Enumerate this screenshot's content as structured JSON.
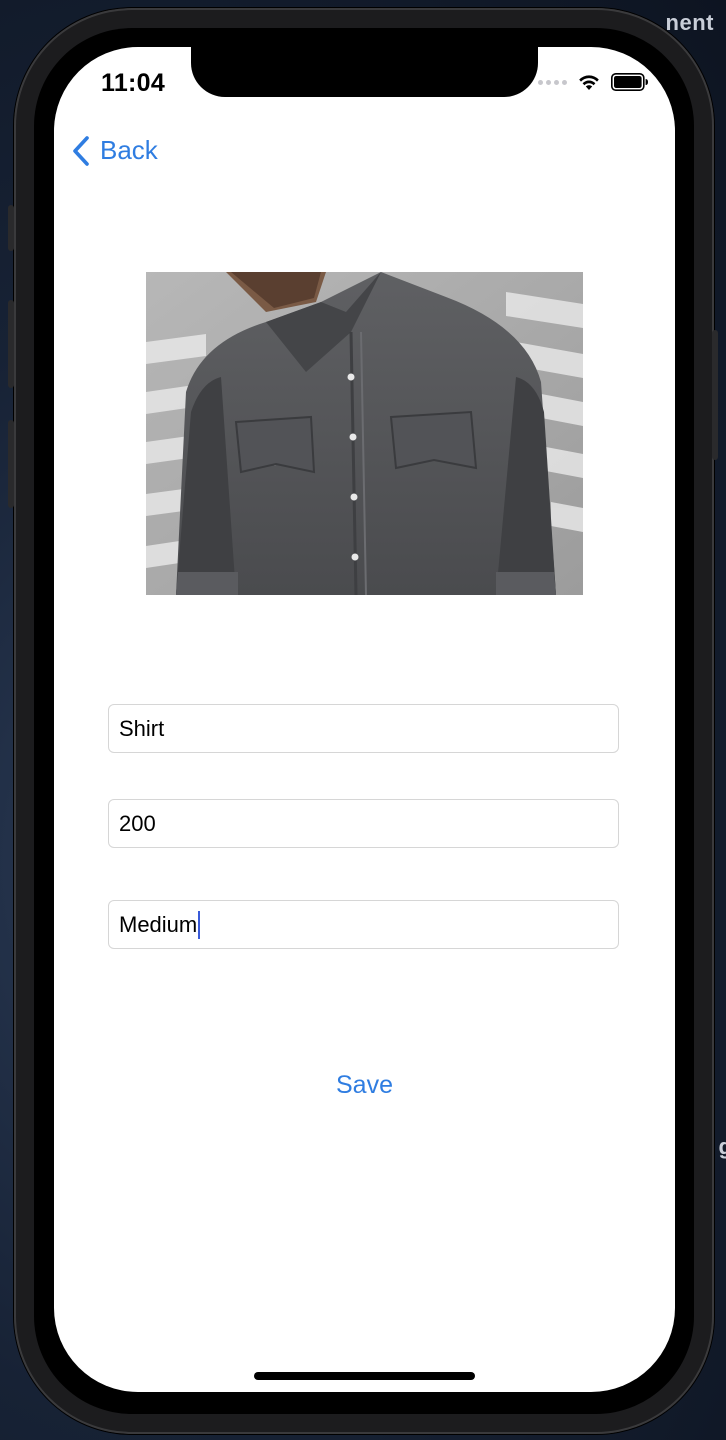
{
  "desktop": {
    "background_label": "nent",
    "background_label_2": "g"
  },
  "status_bar": {
    "time": "11:04",
    "icons": [
      "signal-dots-icon",
      "wifi-icon",
      "battery-icon"
    ]
  },
  "nav": {
    "back_label": "Back",
    "back_icon": "chevron-left-icon"
  },
  "product": {
    "image": "denim-shirt-photo",
    "fields": [
      {
        "value": "Shirt"
      },
      {
        "value": "200"
      },
      {
        "value": "Medium",
        "focused": true
      }
    ]
  },
  "actions": {
    "save_label": "Save"
  },
  "colors": {
    "accent": "#2f7de1",
    "field_border": "#d6d6d6",
    "caret": "#3a5bd9"
  }
}
